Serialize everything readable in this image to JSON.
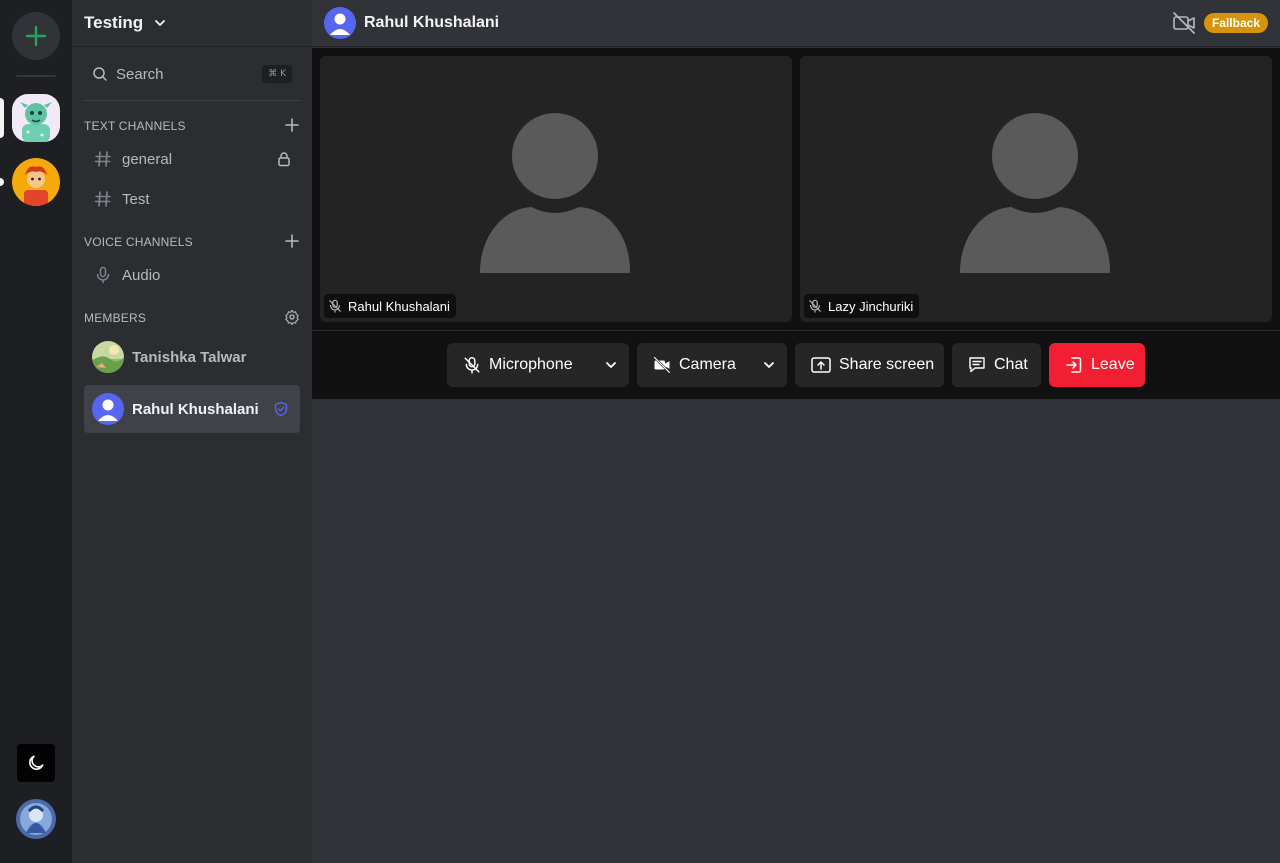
{
  "server": {
    "name": "Testing"
  },
  "search": {
    "label": "Search",
    "shortcut": "⌘ K"
  },
  "sections": {
    "text_channels": "TEXT CHANNELS",
    "voice_channels": "VOICE CHANNELS",
    "members": "MEMBERS"
  },
  "text_channels": [
    {
      "name": "general",
      "locked": true
    },
    {
      "name": "Test",
      "locked": false
    }
  ],
  "voice_channels": [
    {
      "name": "Audio"
    }
  ],
  "members": [
    {
      "name": "Tanishka Talwar",
      "role": "member"
    },
    {
      "name": "Rahul Khushalani",
      "role": "moderator"
    }
  ],
  "topbar": {
    "title": "Rahul Khushalani",
    "badge": "Fallback"
  },
  "participants": [
    {
      "name": "Rahul Khushalani",
      "muted": true
    },
    {
      "name": "Lazy Jinchuriki",
      "muted": true
    }
  ],
  "controls": {
    "microphone": "Microphone",
    "camera": "Camera",
    "share_screen": "Share screen",
    "chat": "Chat",
    "leave": "Leave"
  },
  "colors": {
    "accent_green": "#23a55a",
    "leave_red": "#f21f33",
    "badge_amber": "#d5940b",
    "shield_indigo": "#5865f2"
  }
}
